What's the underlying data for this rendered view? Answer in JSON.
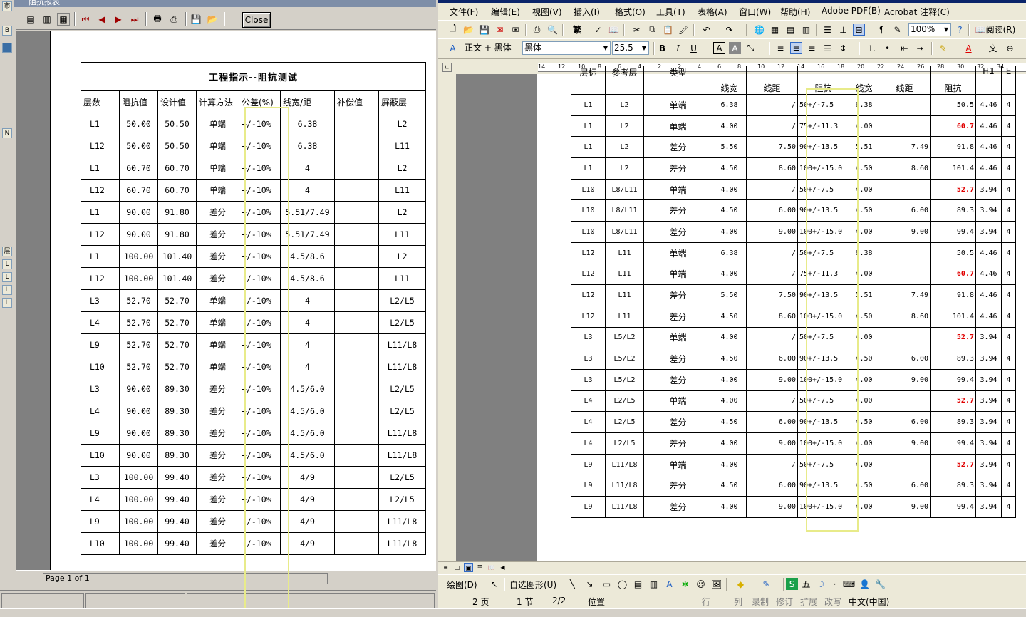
{
  "left_window": {
    "title": "阻抗报表",
    "close_label": "Close",
    "page_info": "Page 1 of 1",
    "strip_labels": [
      "市",
      "B",
      "N",
      "层",
      "L",
      "L",
      "L",
      "L"
    ],
    "report": {
      "title": "工程指示--阻抗测试",
      "headers": [
        "层数",
        "阻抗值",
        "设计值",
        "计算方法",
        "公差(%)",
        "线宽/距",
        "补偿值",
        "屏蔽层"
      ],
      "rows": [
        [
          "L1",
          "50.00",
          "50.50",
          "单端",
          "+/-10%",
          "6.38",
          "",
          "L2"
        ],
        [
          "L12",
          "50.00",
          "50.50",
          "单端",
          "+/-10%",
          "6.38",
          "",
          "L11"
        ],
        [
          "L1",
          "60.70",
          "60.70",
          "单端",
          "+/-10%",
          "4",
          "",
          "L2"
        ],
        [
          "L12",
          "60.70",
          "60.70",
          "单端",
          "+/-10%",
          "4",
          "",
          "L11"
        ],
        [
          "L1",
          "90.00",
          "91.80",
          "差分",
          "+/-10%",
          "5.51/7.49",
          "",
          "L2"
        ],
        [
          "L12",
          "90.00",
          "91.80",
          "差分",
          "+/-10%",
          "5.51/7.49",
          "",
          "L11"
        ],
        [
          "L1",
          "100.00",
          "101.40",
          "差分",
          "+/-10%",
          "4.5/8.6",
          "",
          "L2"
        ],
        [
          "L12",
          "100.00",
          "101.40",
          "差分",
          "+/-10%",
          "4.5/8.6",
          "",
          "L11"
        ],
        [
          "L3",
          "52.70",
          "52.70",
          "单端",
          "+/-10%",
          "4",
          "",
          "L2/L5"
        ],
        [
          "L4",
          "52.70",
          "52.70",
          "单端",
          "+/-10%",
          "4",
          "",
          "L2/L5"
        ],
        [
          "L9",
          "52.70",
          "52.70",
          "单端",
          "+/-10%",
          "4",
          "",
          "L11/L8"
        ],
        [
          "L10",
          "52.70",
          "52.70",
          "单端",
          "+/-10%",
          "4",
          "",
          "L11/L8"
        ],
        [
          "L3",
          "90.00",
          "89.30",
          "差分",
          "+/-10%",
          "4.5/6.0",
          "",
          "L2/L5"
        ],
        [
          "L4",
          "90.00",
          "89.30",
          "差分",
          "+/-10%",
          "4.5/6.0",
          "",
          "L2/L5"
        ],
        [
          "L9",
          "90.00",
          "89.30",
          "差分",
          "+/-10%",
          "4.5/6.0",
          "",
          "L11/L8"
        ],
        [
          "L10",
          "90.00",
          "89.30",
          "差分",
          "+/-10%",
          "4.5/6.0",
          "",
          "L11/L8"
        ],
        [
          "L3",
          "100.00",
          "99.40",
          "差分",
          "+/-10%",
          "4/9",
          "",
          "L2/L5"
        ],
        [
          "L4",
          "100.00",
          "99.40",
          "差分",
          "+/-10%",
          "4/9",
          "",
          "L2/L5"
        ],
        [
          "L9",
          "100.00",
          "99.40",
          "差分",
          "+/-10%",
          "4/9",
          "",
          "L11/L8"
        ],
        [
          "L10",
          "100.00",
          "99.40",
          "差分",
          "+/-10%",
          "4/9",
          "",
          "L11/L8"
        ]
      ]
    },
    "toolbar_icons": [
      "page-width-icon",
      "one-page-icon",
      "zoom-page-icon",
      "first-page-icon",
      "prev-page-icon",
      "next-page-icon",
      "last-page-icon",
      "print-setup-icon",
      "print-icon",
      "save-icon",
      "open-icon"
    ]
  },
  "word_window": {
    "menu": [
      "文件(F)",
      "编辑(E)",
      "视图(V)",
      "插入(I)",
      "格式(O)",
      "工具(T)",
      "表格(A)",
      "窗口(W)",
      "帮助(H)",
      "Adobe PDF(B)",
      "Acrobat 注释(C)"
    ],
    "toolbar": {
      "traditional_label": "繁",
      "zoom": "100%",
      "read_label": "阅读(R)",
      "style": "正文 + 黑体",
      "font": "黑体",
      "font_size": "25.5",
      "bold": "B",
      "italic": "I",
      "underline": "U"
    },
    "ruler_ticks": [
      "14",
      "12",
      "10",
      "8",
      "6",
      "4",
      "2",
      "2",
      "4",
      "6",
      "8",
      "10",
      "12",
      "14",
      "16",
      "18",
      "20",
      "22",
      "24",
      "26",
      "28",
      "30",
      "32",
      "34"
    ],
    "table": {
      "header_top": [
        "层标",
        "参考层",
        "类型",
        "线宽",
        "线距",
        "阻抗",
        "线宽",
        "线距",
        "阻抗",
        "H1",
        "E"
      ],
      "rows": [
        [
          "L1",
          "L2",
          "单端",
          "6.38",
          "/",
          "50+/-7.5",
          "6.38",
          "",
          "50.5",
          "4.46",
          "4"
        ],
        [
          "L1",
          "L2",
          "单端",
          "4.00",
          "/",
          "75+/-11.3",
          "4.00",
          "",
          "60.7",
          "4.46",
          "4"
        ],
        [
          "L1",
          "L2",
          "差分",
          "5.50",
          "7.50",
          "90+/-13.5",
          "5.51",
          "7.49",
          "91.8",
          "4.46",
          "4"
        ],
        [
          "L1",
          "L2",
          "差分",
          "4.50",
          "8.60",
          "100+/-15.0",
          "4.50",
          "8.60",
          "101.4",
          "4.46",
          "4"
        ],
        [
          "L10",
          "L8/L11",
          "单端",
          "4.00",
          "/",
          "50+/-7.5",
          "4.00",
          "",
          "52.7",
          "3.94",
          "4"
        ],
        [
          "L10",
          "L8/L11",
          "差分",
          "4.50",
          "6.00",
          "90+/-13.5",
          "4.50",
          "6.00",
          "89.3",
          "3.94",
          "4"
        ],
        [
          "L10",
          "L8/L11",
          "差分",
          "4.00",
          "9.00",
          "100+/-15.0",
          "4.00",
          "9.00",
          "99.4",
          "3.94",
          "4"
        ],
        [
          "L12",
          "L11",
          "单端",
          "6.38",
          "/",
          "50+/-7.5",
          "6.38",
          "",
          "50.5",
          "4.46",
          "4"
        ],
        [
          "L12",
          "L11",
          "单端",
          "4.00",
          "/",
          "75+/-11.3",
          "4.00",
          "",
          "60.7",
          "4.46",
          "4"
        ],
        [
          "L12",
          "L11",
          "差分",
          "5.50",
          "7.50",
          "90+/-13.5",
          "5.51",
          "7.49",
          "91.8",
          "4.46",
          "4"
        ],
        [
          "L12",
          "L11",
          "差分",
          "4.50",
          "8.60",
          "100+/-15.0",
          "4.50",
          "8.60",
          "101.4",
          "4.46",
          "4"
        ],
        [
          "L3",
          "L5/L2",
          "单端",
          "4.00",
          "/",
          "50+/-7.5",
          "4.00",
          "",
          "52.7",
          "3.94",
          "4"
        ],
        [
          "L3",
          "L5/L2",
          "差分",
          "4.50",
          "6.00",
          "90+/-13.5",
          "4.50",
          "6.00",
          "89.3",
          "3.94",
          "4"
        ],
        [
          "L3",
          "L5/L2",
          "差分",
          "4.00",
          "9.00",
          "100+/-15.0",
          "4.00",
          "9.00",
          "99.4",
          "3.94",
          "4"
        ],
        [
          "L4",
          "L2/L5",
          "单端",
          "4.00",
          "/",
          "50+/-7.5",
          "4.00",
          "",
          "52.7",
          "3.94",
          "4"
        ],
        [
          "L4",
          "L2/L5",
          "差分",
          "4.50",
          "6.00",
          "90+/-13.5",
          "4.50",
          "6.00",
          "89.3",
          "3.94",
          "4"
        ],
        [
          "L4",
          "L2/L5",
          "差分",
          "4.00",
          "9.00",
          "100+/-15.0",
          "4.00",
          "9.00",
          "99.4",
          "3.94",
          "4"
        ],
        [
          "L9",
          "L11/L8",
          "单端",
          "4.00",
          "/",
          "50+/-7.5",
          "4.00",
          "",
          "52.7",
          "3.94",
          "4"
        ],
        [
          "L9",
          "L11/L8",
          "差分",
          "4.50",
          "6.00",
          "90+/-13.5",
          "4.50",
          "6.00",
          "89.3",
          "3.94",
          "4"
        ],
        [
          "L9",
          "L11/L8",
          "差分",
          "4.00",
          "9.00",
          "100+/-15.0",
          "4.00",
          "9.00",
          "99.4",
          "3.94",
          "4"
        ]
      ],
      "red_values": [
        "60.7",
        "52.7"
      ]
    },
    "draw_toolbar": {
      "draw_label": "绘图(D)",
      "autoshape_label": "自选图形(U)",
      "ime_label": "五"
    },
    "status": {
      "page": "2 页",
      "section": "1 节",
      "page_of": "2/2",
      "position": "位置",
      "line": "行",
      "col": "列",
      "rec": "录制",
      "trk": "修订",
      "ext": "扩展",
      "ovr": "改写",
      "lang": "中文(中国)"
    },
    "highlight_color": "#e8eb8a"
  }
}
